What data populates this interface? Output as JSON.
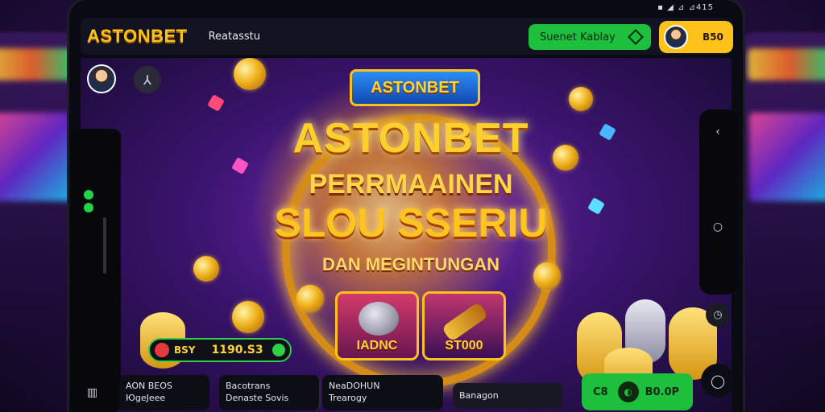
{
  "status_bar": {
    "text": "▪︎ ◢ ⊿ ⊿415"
  },
  "top_bar": {
    "logo": "ASTONBET",
    "app_title": "Reatasstu",
    "green_button_label": "Suenet Kablay",
    "balance": "B50"
  },
  "game": {
    "banner": "ASTONBET",
    "title_main": "ASTONBET",
    "title_sub": "PERRMAAINEN",
    "title_big": "SLOU SSERIU",
    "tagline": "DAN MEGINTUNGAN",
    "cards": [
      {
        "label": "IADNC"
      },
      {
        "label": "ST000"
      }
    ],
    "win_pill": {
      "label": "BSY",
      "value": "1190.S3"
    }
  },
  "bottom_bar": {
    "cell1": {
      "line1": "AON BEOS",
      "line2": "ЮgeJeee"
    },
    "cell2": {
      "line1": "Bacotrans",
      "line2": "Denaste Sovis"
    },
    "cell3": {
      "line1": "NeaDOHUN",
      "line2": "Trearogy"
    },
    "cell4": {
      "line1": "Banagon"
    },
    "bet_button": {
      "label": "C8",
      "amount": "B0.0P"
    }
  },
  "colors": {
    "accent": "#ffc21a",
    "green": "#1fbf3e",
    "frame": "#0a0a12"
  }
}
